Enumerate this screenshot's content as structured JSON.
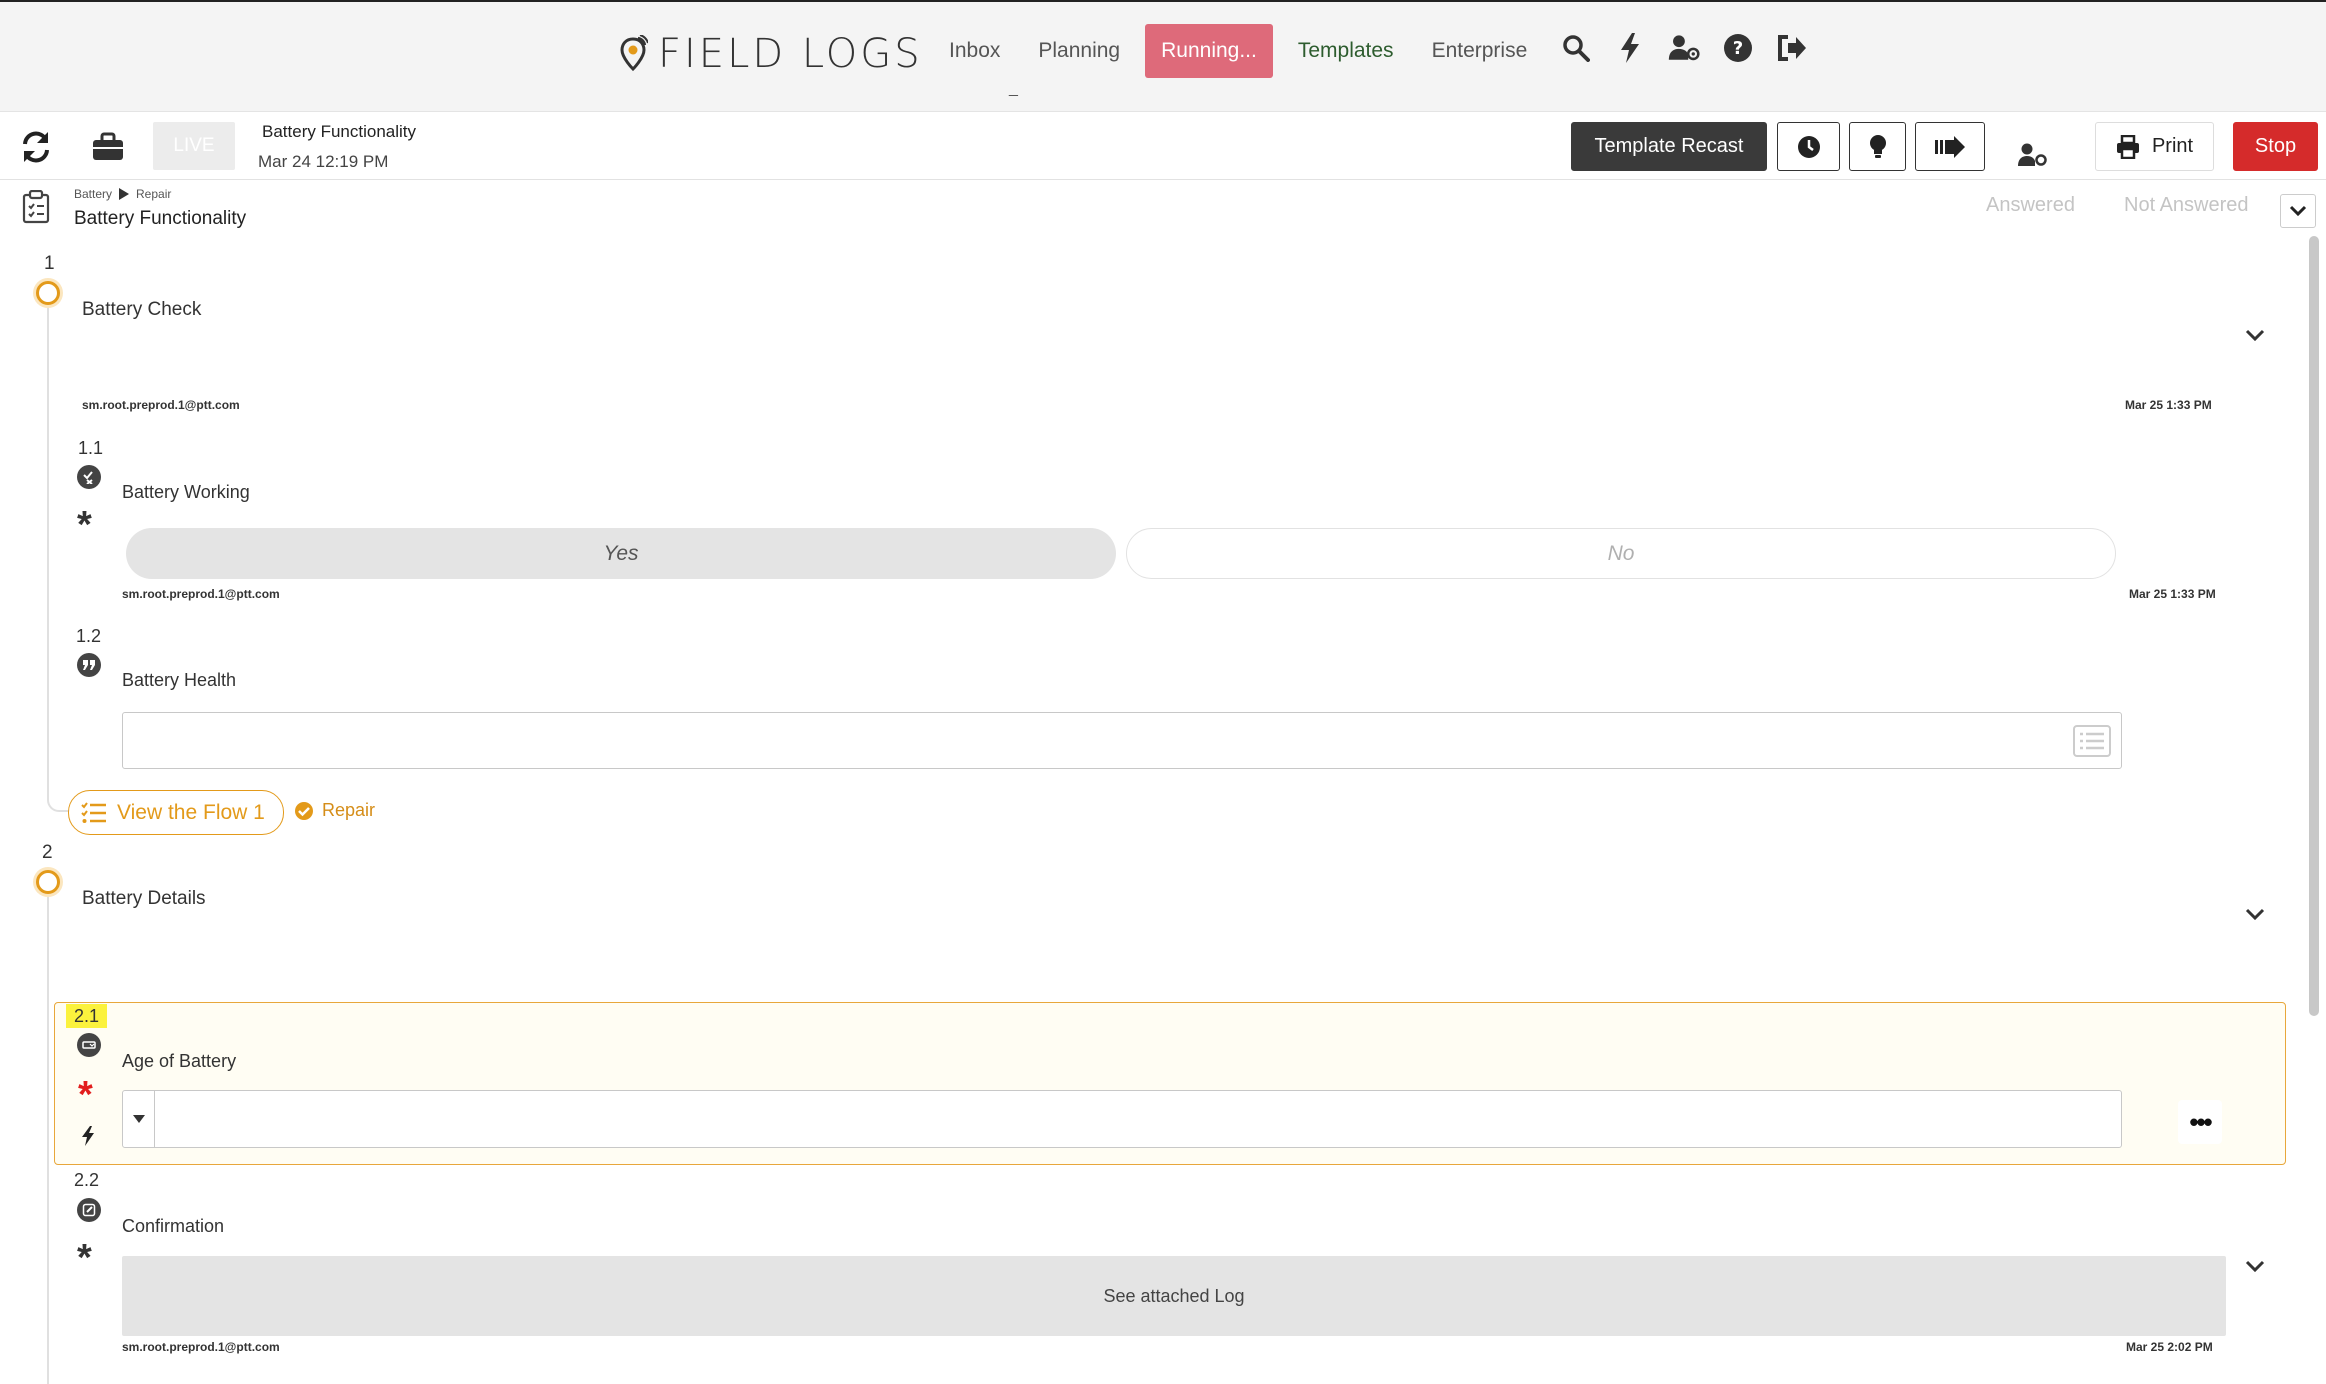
{
  "app": {
    "logo_text": "FIELD LOGS"
  },
  "nav": {
    "items": [
      {
        "label": "Inbox"
      },
      {
        "label": "Planning"
      },
      {
        "label": "Running..."
      },
      {
        "label": "Templates"
      },
      {
        "label": "Enterprise"
      }
    ],
    "underscore": "_",
    "icons": [
      "search-icon",
      "bolt-icon",
      "user-settings-icon",
      "help-icon",
      "logout-icon"
    ]
  },
  "toolbar": {
    "live_label": "LIVE",
    "title": "Battery Functionality",
    "date": "Mar 24 12:19 PM",
    "template_recast_label": "Template Recast",
    "print_label": "Print",
    "stop_label": "Stop",
    "icons": [
      "refresh-icon",
      "briefcase-icon",
      "clock-icon",
      "lightbulb-icon",
      "forward-icon",
      "user-gear-icon",
      "printer-icon"
    ]
  },
  "header": {
    "breadcrumb": [
      "Battery",
      "Repair"
    ],
    "title": "Battery Functionality",
    "filter_answered": "Answered",
    "filter_not_answered": "Not Answered"
  },
  "sections": [
    {
      "number": "1",
      "title": "Battery Check",
      "user": "sm.root.preprod.1@ptt.com",
      "time": "Mar 25 1:33 PM",
      "questions": [
        {
          "number": "1.1",
          "label": "Battery Working",
          "options": [
            "Yes",
            "No"
          ],
          "selected": "Yes",
          "user": "sm.root.preprod.1@ptt.com",
          "time": "Mar 25 1:33 PM"
        },
        {
          "number": "1.2",
          "label": "Battery Health",
          "value": ""
        }
      ],
      "flow_button_label": "View the Flow 1",
      "flow_link_label": "Repair"
    },
    {
      "number": "2",
      "title": "Battery Details",
      "questions": [
        {
          "number": "2.1",
          "label": "Age of Battery",
          "value": "",
          "more_label": "•••"
        },
        {
          "number": "2.2",
          "label": "Confirmation",
          "attached_label": "See attached Log",
          "user": "sm.root.preprod.1@ptt.com",
          "time": "Mar 25 2:02 PM"
        }
      ]
    }
  ],
  "colors": {
    "accent": "#e39a1a",
    "running": "#de6a7a",
    "stop": "#d52b2b",
    "templates": "#2d5c2e",
    "highlight": "#fbf23d"
  }
}
